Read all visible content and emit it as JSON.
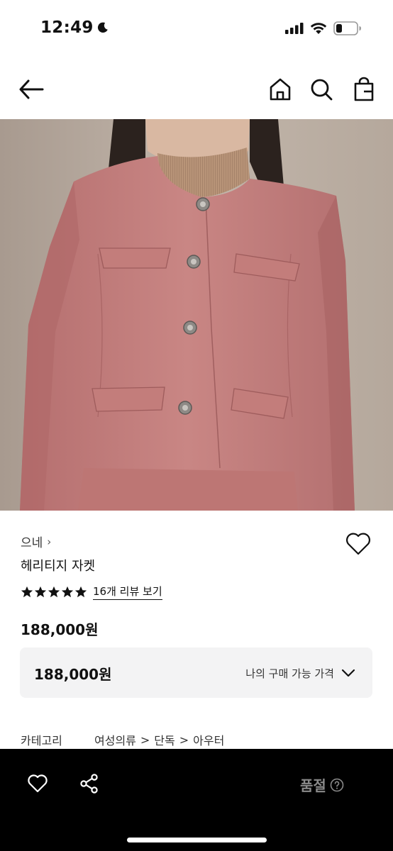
{
  "status_bar": {
    "time": "12:49",
    "icons": [
      "moon-icon",
      "cellular-signal-icon",
      "wifi-icon",
      "battery-icon"
    ]
  },
  "nav": {
    "icons": [
      "back-arrow-icon",
      "home-icon",
      "search-icon",
      "shopping-bag-icon"
    ]
  },
  "product": {
    "image_subject": "pink collarless cropped jacket worn over beige mock-neck knit",
    "brand": "으네",
    "brand_chevron": "›",
    "name": "헤리티지 자켓",
    "rating_stars": 5,
    "review_link": "16개 리뷰 보기",
    "price": "188,000원"
  },
  "my_price": {
    "value": "188,000원",
    "label": "나의 구매 가능 가격"
  },
  "category": {
    "label": "카테고리",
    "path": [
      "여성의류",
      "단독",
      "아우터"
    ],
    "separator": ">"
  },
  "bottom_bar": {
    "status": "품절",
    "icons": [
      "heart-outline-icon",
      "share-icon",
      "help-circle-icon"
    ]
  },
  "colors": {
    "jacket": "#c47f7d",
    "background_wall": "#b8aba0",
    "bottom_bar": "#000000",
    "soldout_text": "#8a8a8a",
    "price_box": "#f3f3f4"
  }
}
